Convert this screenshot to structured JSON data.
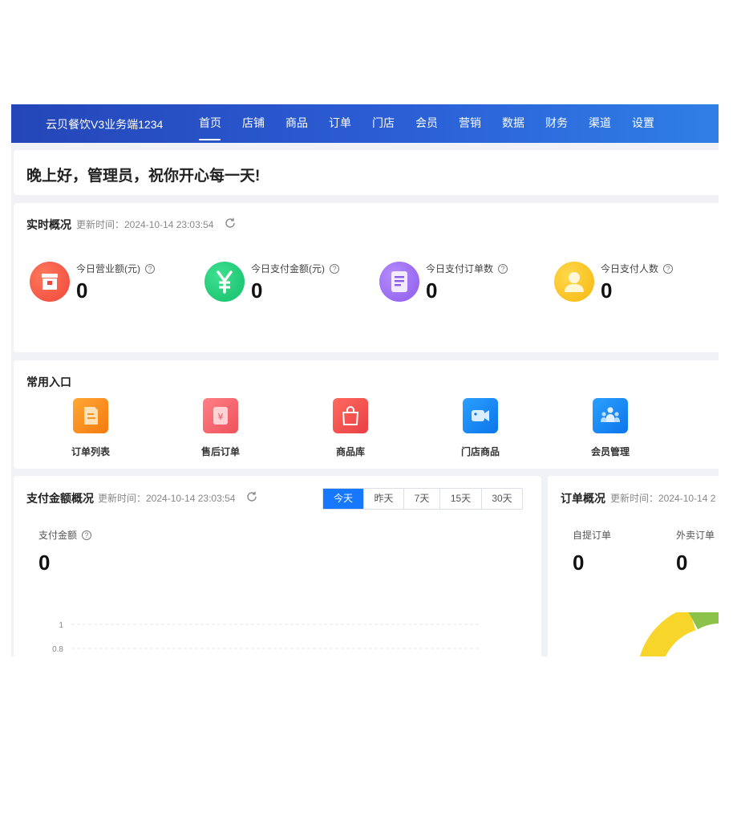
{
  "header": {
    "brand": "云贝餐饮V3业务端1234",
    "nav": [
      {
        "label": "首页",
        "active": true
      },
      {
        "label": "店铺"
      },
      {
        "label": "商品"
      },
      {
        "label": "订单"
      },
      {
        "label": "门店"
      },
      {
        "label": "会员"
      },
      {
        "label": "营销"
      },
      {
        "label": "数据"
      },
      {
        "label": "财务"
      },
      {
        "label": "渠道"
      },
      {
        "label": "设置"
      }
    ]
  },
  "greeting": "晚上好，管理员，祝你开心每一天!",
  "realtime": {
    "title": "实时概况",
    "update_label": "更新时间：2024-10-14 23:03:54",
    "stats": [
      {
        "label": "今日营业额(元)",
        "value": "0",
        "icon": "shop-icon",
        "color": "#f5533d"
      },
      {
        "label": "今日支付金额(元)",
        "value": "0",
        "icon": "yen-icon",
        "color": "#1fc97a"
      },
      {
        "label": "今日支付订单数",
        "value": "0",
        "icon": "document-icon",
        "color": "#9b6cf0"
      },
      {
        "label": "今日支付人数",
        "value": "0",
        "icon": "user-icon",
        "color": "#fbc21e"
      }
    ]
  },
  "shortcuts": {
    "title": "常用入口",
    "items": [
      {
        "label": "订单列表",
        "icon": "order-list-icon",
        "color": "#f7931e"
      },
      {
        "label": "售后订单",
        "icon": "after-sale-icon",
        "color": "#f2646d"
      },
      {
        "label": "商品库",
        "icon": "shopping-bag-icon",
        "color": "#ef4e4e"
      },
      {
        "label": "门店商品",
        "icon": "video-camera-icon",
        "color": "#1f8cf5"
      },
      {
        "label": "会员管理",
        "icon": "members-icon",
        "color": "#1f8cf5"
      }
    ]
  },
  "payment": {
    "title": "支付金额概况",
    "update_label": "更新时间：2024-10-14 23:03:54",
    "ranges": [
      {
        "label": "今天",
        "active": true
      },
      {
        "label": "昨天"
      },
      {
        "label": "7天"
      },
      {
        "label": "15天"
      },
      {
        "label": "30天"
      }
    ],
    "metric_label": "支付金额",
    "metric_value": "0",
    "chart_ticks": [
      "1",
      "0.8"
    ]
  },
  "orders": {
    "title": "订单概况",
    "update_label": "更新时间：2024-10-14 2",
    "metrics": [
      {
        "label": "自提订单",
        "value": "0"
      },
      {
        "label": "外卖订单",
        "value": "0"
      }
    ]
  },
  "colors": {
    "accent": "#1677ff",
    "donut_primary": "#f7d52a",
    "donut_secondary": "#8bc34a"
  }
}
